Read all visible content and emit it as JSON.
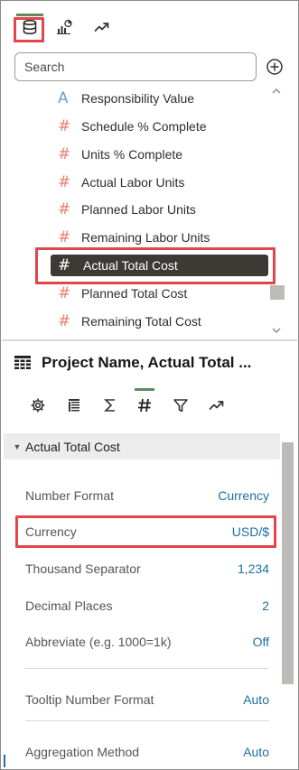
{
  "toolbar": {
    "tabs": [
      {
        "icon": "database-icon",
        "active": true
      },
      {
        "icon": "chart-icon",
        "active": false
      },
      {
        "icon": "trend-icon",
        "active": false
      }
    ]
  },
  "search": {
    "placeholder": "Search"
  },
  "list": {
    "items": [
      {
        "symbol": "A",
        "label": "Responsibility Value",
        "kind": "attribute"
      },
      {
        "symbol": "#",
        "label": "Schedule % Complete",
        "kind": "measure"
      },
      {
        "symbol": "#",
        "label": "Units % Complete",
        "kind": "measure"
      },
      {
        "symbol": "#",
        "label": "Actual Labor Units",
        "kind": "measure"
      },
      {
        "symbol": "#",
        "label": "Planned Labor Units",
        "kind": "measure"
      },
      {
        "symbol": "#",
        "label": "Remaining Labor Units",
        "kind": "measure"
      },
      {
        "symbol": "#",
        "label": "Actual Total Cost",
        "kind": "measure",
        "selected": true
      },
      {
        "symbol": "#",
        "label": "Planned Total Cost",
        "kind": "measure"
      },
      {
        "symbol": "#",
        "label": "Remaining Total Cost",
        "kind": "measure"
      }
    ]
  },
  "properties": {
    "title": "Project Name, Actual Total ...",
    "tabs": [
      "gear-icon",
      "table-icon",
      "sigma-icon",
      "number-icon",
      "filter-icon",
      "trend-icon"
    ],
    "section": "Actual Total Cost",
    "rows": [
      {
        "label": "Number Format",
        "value": "Currency"
      },
      {
        "label": "Currency",
        "value": "USD/$"
      },
      {
        "label": "Thousand Separator",
        "value": "1,234"
      },
      {
        "label": "Decimal Places",
        "value": "2"
      },
      {
        "label": "Abbreviate (e.g. 1000=1k)",
        "value": "Off"
      },
      {
        "label": "Tooltip Number Format",
        "value": "Auto"
      },
      {
        "label": "Aggregation Method",
        "value": "Auto"
      }
    ]
  },
  "colors": {
    "measure": "#ef7d6f",
    "attribute": "#6ba0c7",
    "selected_bg": "#3d3a36",
    "value_link": "#1b6fa0",
    "highlight": "#e0464b"
  }
}
